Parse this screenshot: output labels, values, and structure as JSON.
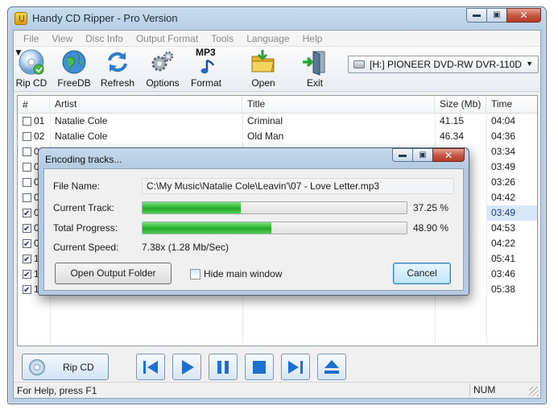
{
  "window": {
    "title": "Handy CD Ripper - Pro Version"
  },
  "menu": [
    "File",
    "View",
    "Disc Info",
    "Output Format",
    "Tools",
    "Language",
    "Help"
  ],
  "toolbar": {
    "rip_cd": "Rip CD",
    "freedb": "FreeDB",
    "refresh": "Refresh",
    "options": "Options",
    "format_badge": "MP3",
    "format": "Format",
    "open": "Open",
    "exit": "Exit"
  },
  "drive": {
    "selected": "[H:] PIONEER DVD-RW  DVR-110D"
  },
  "columns": {
    "num": "#",
    "artist": "Artist",
    "title": "Title",
    "size": "Size (Mb)",
    "time": "Time"
  },
  "tracks": [
    {
      "num": "01",
      "artist": "Natalie Cole",
      "title": "Criminal",
      "size": "41.15",
      "time": "04:04",
      "checked": false
    },
    {
      "num": "02",
      "artist": "Natalie Cole",
      "title": "Old Man",
      "size": "46.34",
      "time": "04:36",
      "checked": false
    },
    {
      "num": "03",
      "artist": "",
      "title": "",
      "size": "",
      "time": "03:34",
      "checked": false
    },
    {
      "num": "0",
      "artist": "",
      "title": "",
      "size": "",
      "time": "03:49",
      "checked": false
    },
    {
      "num": "0",
      "artist": "",
      "title": "",
      "size": "",
      "time": "03:26",
      "checked": false
    },
    {
      "num": "0",
      "artist": "",
      "title": "",
      "size": "",
      "time": "04:42",
      "checked": false
    },
    {
      "num": "0",
      "artist": "",
      "title": "",
      "size": "",
      "time": "03:49",
      "checked": true,
      "selected": true
    },
    {
      "num": "0",
      "artist": "",
      "title": "",
      "size": "",
      "time": "04:53",
      "checked": true
    },
    {
      "num": "0",
      "artist": "",
      "title": "",
      "size": "",
      "time": "04:22",
      "checked": true
    },
    {
      "num": "1",
      "artist": "",
      "title": "",
      "size": "",
      "time": "05:41",
      "checked": true
    },
    {
      "num": "1",
      "artist": "",
      "title": "",
      "size": "",
      "time": "03:46",
      "checked": true
    },
    {
      "num": "1",
      "artist": "",
      "title": "",
      "size": "",
      "time": "05:38",
      "checked": true
    }
  ],
  "player": {
    "rip_cd": "Rip CD"
  },
  "status": {
    "message": "For Help, press F1",
    "num": "NUM"
  },
  "dialog": {
    "title": "Encoding tracks...",
    "file_name_label": "File Name:",
    "file_name": "C:\\My Music\\Natalie Cole\\Leavin'\\07 - Love Letter.mp3",
    "current_track_label": "Current Track:",
    "current_track_pct": "37.25 %",
    "current_track_value": 37.25,
    "total_progress_label": "Total Progress:",
    "total_progress_pct": "48.90 %",
    "total_progress_value": 48.9,
    "current_speed_label": "Current Speed:",
    "current_speed": "7.38x (1.28 Mb/Sec)",
    "open_folder": "Open Output Folder",
    "hide_main": "Hide main window",
    "cancel": "Cancel"
  }
}
